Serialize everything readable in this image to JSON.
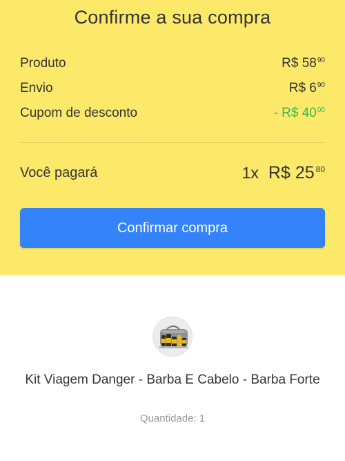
{
  "summary": {
    "title": "Confirme a sua compra",
    "rows": [
      {
        "label": "Produto",
        "currency": "R$",
        "amount": "58",
        "cents": "90"
      },
      {
        "label": "Envio",
        "currency": "R$",
        "amount": "6",
        "cents": "90"
      },
      {
        "label": "Cupom de desconto",
        "currency": "- R$",
        "amount": "40",
        "cents": "00"
      }
    ],
    "total": {
      "label": "Você pagará",
      "quantity": "1x",
      "currency": "R$",
      "amount": "25",
      "cents": "80"
    },
    "confirm_label": "Confirmar compra"
  },
  "product": {
    "name": "Kit Viagem Danger - Barba E Cabelo - Barba Forte",
    "quantity_text": "Quantidade: 1",
    "image_icon": "product-kit-image"
  },
  "colors": {
    "summary_background": "#fce96a",
    "button_background": "#3483fa",
    "discount_text": "#39b54a"
  }
}
